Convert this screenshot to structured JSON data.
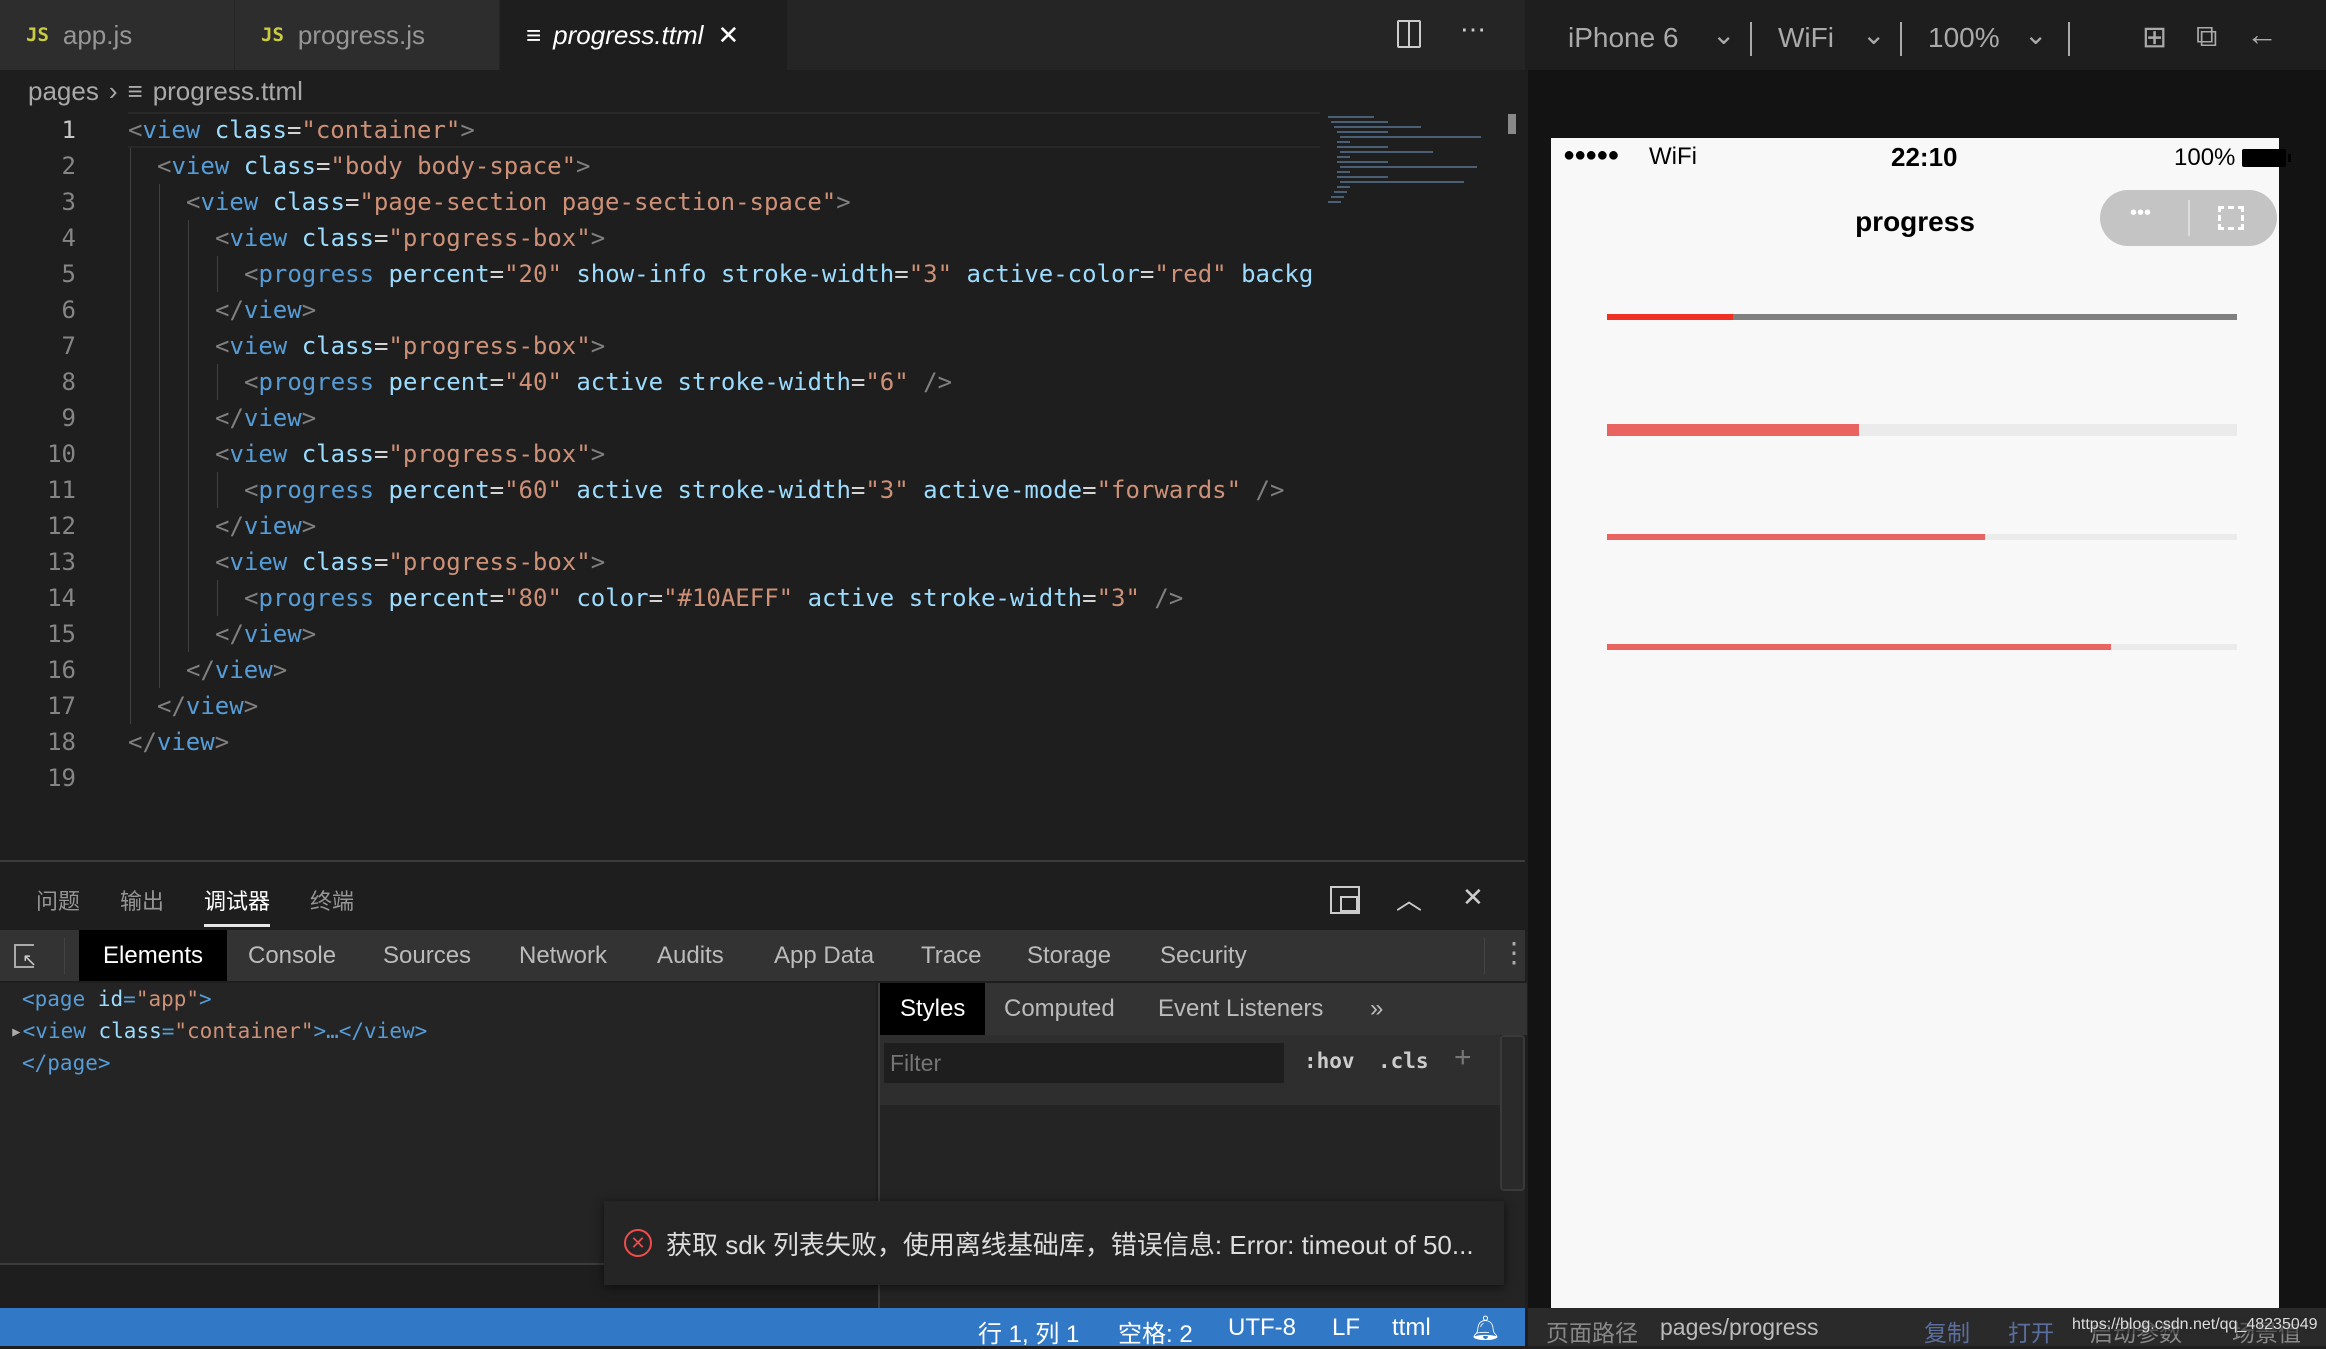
{
  "editor": {
    "tabs": [
      {
        "label": "app.js",
        "icon": "js-icon",
        "badge": "JS"
      },
      {
        "label": "progress.js",
        "icon": "js-icon",
        "badge": "JS"
      },
      {
        "label": "progress.ttml",
        "icon": "file-lines-icon",
        "active": true
      }
    ],
    "breadcrumb": [
      "pages",
      "progress.ttml"
    ],
    "lines": [
      {
        "n": "1",
        "indent": 0,
        "tokens": [
          [
            "pun",
            "<"
          ],
          [
            "tag",
            "view"
          ],
          [
            "txt",
            " "
          ],
          [
            "attr",
            "class"
          ],
          [
            "txt",
            "="
          ],
          [
            "str",
            "\"container\""
          ],
          [
            "pun",
            ">"
          ]
        ]
      },
      {
        "n": "2",
        "indent": 1,
        "tokens": [
          [
            "pun",
            "<"
          ],
          [
            "tag",
            "view"
          ],
          [
            "txt",
            " "
          ],
          [
            "attr",
            "class"
          ],
          [
            "txt",
            "="
          ],
          [
            "str",
            "\"body body-space\""
          ],
          [
            "pun",
            ">"
          ]
        ]
      },
      {
        "n": "3",
        "indent": 2,
        "tokens": [
          [
            "pun",
            "<"
          ],
          [
            "tag",
            "view"
          ],
          [
            "txt",
            " "
          ],
          [
            "attr",
            "class"
          ],
          [
            "txt",
            "="
          ],
          [
            "str",
            "\"page-section page-section-space\""
          ],
          [
            "pun",
            ">"
          ]
        ]
      },
      {
        "n": "4",
        "indent": 3,
        "tokens": [
          [
            "pun",
            "<"
          ],
          [
            "tag",
            "view"
          ],
          [
            "txt",
            " "
          ],
          [
            "attr",
            "class"
          ],
          [
            "txt",
            "="
          ],
          [
            "str",
            "\"progress-box\""
          ],
          [
            "pun",
            ">"
          ]
        ]
      },
      {
        "n": "5",
        "indent": 4,
        "tokens": [
          [
            "pun",
            "<"
          ],
          [
            "tag",
            "progress"
          ],
          [
            "txt",
            " "
          ],
          [
            "attr",
            "percent"
          ],
          [
            "txt",
            "="
          ],
          [
            "str",
            "\"20\""
          ],
          [
            "txt",
            " "
          ],
          [
            "attr",
            "show-info"
          ],
          [
            "txt",
            " "
          ],
          [
            "attr",
            "stroke-width"
          ],
          [
            "txt",
            "="
          ],
          [
            "str",
            "\"3\""
          ],
          [
            "txt",
            " "
          ],
          [
            "attr",
            "active-color"
          ],
          [
            "txt",
            "="
          ],
          [
            "str",
            "\"red\""
          ],
          [
            "txt",
            " "
          ],
          [
            "attr",
            "backg"
          ]
        ]
      },
      {
        "n": "6",
        "indent": 3,
        "tokens": [
          [
            "pun",
            "</"
          ],
          [
            "tag",
            "view"
          ],
          [
            "pun",
            ">"
          ]
        ]
      },
      {
        "n": "7",
        "indent": 3,
        "tokens": [
          [
            "pun",
            "<"
          ],
          [
            "tag",
            "view"
          ],
          [
            "txt",
            " "
          ],
          [
            "attr",
            "class"
          ],
          [
            "txt",
            "="
          ],
          [
            "str",
            "\"progress-box\""
          ],
          [
            "pun",
            ">"
          ]
        ]
      },
      {
        "n": "8",
        "indent": 4,
        "tokens": [
          [
            "pun",
            "<"
          ],
          [
            "tag",
            "progress"
          ],
          [
            "txt",
            " "
          ],
          [
            "attr",
            "percent"
          ],
          [
            "txt",
            "="
          ],
          [
            "str",
            "\"40\""
          ],
          [
            "txt",
            " "
          ],
          [
            "attr",
            "active"
          ],
          [
            "txt",
            " "
          ],
          [
            "attr",
            "stroke-width"
          ],
          [
            "txt",
            "="
          ],
          [
            "str",
            "\"6\""
          ],
          [
            "txt",
            " "
          ],
          [
            "pun",
            "/>"
          ]
        ]
      },
      {
        "n": "9",
        "indent": 3,
        "tokens": [
          [
            "pun",
            "</"
          ],
          [
            "tag",
            "view"
          ],
          [
            "pun",
            ">"
          ]
        ]
      },
      {
        "n": "10",
        "indent": 3,
        "tokens": [
          [
            "pun",
            "<"
          ],
          [
            "tag",
            "view"
          ],
          [
            "txt",
            " "
          ],
          [
            "attr",
            "class"
          ],
          [
            "txt",
            "="
          ],
          [
            "str",
            "\"progress-box\""
          ],
          [
            "pun",
            ">"
          ]
        ]
      },
      {
        "n": "11",
        "indent": 4,
        "tokens": [
          [
            "pun",
            "<"
          ],
          [
            "tag",
            "progress"
          ],
          [
            "txt",
            " "
          ],
          [
            "attr",
            "percent"
          ],
          [
            "txt",
            "="
          ],
          [
            "str",
            "\"60\""
          ],
          [
            "txt",
            " "
          ],
          [
            "attr",
            "active"
          ],
          [
            "txt",
            " "
          ],
          [
            "attr",
            "stroke-width"
          ],
          [
            "txt",
            "="
          ],
          [
            "str",
            "\"3\""
          ],
          [
            "txt",
            " "
          ],
          [
            "attr",
            "active-mode"
          ],
          [
            "txt",
            "="
          ],
          [
            "str",
            "\"forwards\""
          ],
          [
            "txt",
            " "
          ],
          [
            "pun",
            "/>"
          ]
        ]
      },
      {
        "n": "12",
        "indent": 3,
        "tokens": [
          [
            "pun",
            "</"
          ],
          [
            "tag",
            "view"
          ],
          [
            "pun",
            ">"
          ]
        ]
      },
      {
        "n": "13",
        "indent": 3,
        "tokens": [
          [
            "pun",
            "<"
          ],
          [
            "tag",
            "view"
          ],
          [
            "txt",
            " "
          ],
          [
            "attr",
            "class"
          ],
          [
            "txt",
            "="
          ],
          [
            "str",
            "\"progress-box\""
          ],
          [
            "pun",
            ">"
          ]
        ]
      },
      {
        "n": "14",
        "indent": 4,
        "tokens": [
          [
            "pun",
            "<"
          ],
          [
            "tag",
            "progress"
          ],
          [
            "txt",
            " "
          ],
          [
            "attr",
            "percent"
          ],
          [
            "txt",
            "="
          ],
          [
            "str",
            "\"80\""
          ],
          [
            "txt",
            " "
          ],
          [
            "attr",
            "color"
          ],
          [
            "txt",
            "="
          ],
          [
            "str",
            "\"#10AEFF\""
          ],
          [
            "txt",
            " "
          ],
          [
            "attr",
            "active"
          ],
          [
            "txt",
            " "
          ],
          [
            "attr",
            "stroke-width"
          ],
          [
            "txt",
            "="
          ],
          [
            "str",
            "\"3\""
          ],
          [
            "txt",
            " "
          ],
          [
            "pun",
            "/>"
          ]
        ]
      },
      {
        "n": "15",
        "indent": 3,
        "tokens": [
          [
            "pun",
            "</"
          ],
          [
            "tag",
            "view"
          ],
          [
            "pun",
            ">"
          ]
        ]
      },
      {
        "n": "16",
        "indent": 2,
        "tokens": [
          [
            "pun",
            "</"
          ],
          [
            "tag",
            "view"
          ],
          [
            "pun",
            ">"
          ]
        ]
      },
      {
        "n": "17",
        "indent": 1,
        "tokens": [
          [
            "pun",
            "</"
          ],
          [
            "tag",
            "view"
          ],
          [
            "pun",
            ">"
          ]
        ]
      },
      {
        "n": "18",
        "indent": 0,
        "tokens": [
          [
            "pun",
            "</"
          ],
          [
            "tag",
            "view"
          ],
          [
            "pun",
            ">"
          ]
        ]
      },
      {
        "n": "19",
        "indent": 0,
        "tokens": []
      }
    ]
  },
  "panel": {
    "tabs": [
      "问题",
      "输出",
      "调试器",
      "终端"
    ],
    "active_tab": "调试器",
    "devtools_tabs": [
      "Elements",
      "Console",
      "Sources",
      "Network",
      "Audits",
      "App Data",
      "Trace",
      "Storage",
      "Security"
    ],
    "elements": {
      "line1_open": "<page ",
      "line1_attr": "id",
      "line1_eq": "=",
      "line1_val": "\"app\"",
      "line1_close": ">",
      "line2_open": "<view ",
      "line2_attr": "class",
      "line2_eq": "=",
      "line2_val": "\"container\"",
      "line2_close": ">…</view>",
      "line3": "</page>"
    },
    "styles_tabs": [
      "Styles",
      "Computed",
      "Event Listeners",
      "»"
    ],
    "filter_placeholder": "Filter",
    "hov": ":hov",
    "cls": ".cls",
    "plus": "+",
    "toast": "获取 sdk 列表失败，使用离线基础库，错误信息: Error: timeout of 50..."
  },
  "statusbar": {
    "position": "行 1, 列 1",
    "spaces": "空格: 2",
    "encoding": "UTF-8",
    "eol": "LF",
    "language": "ttml"
  },
  "simulator": {
    "device": "iPhone 6",
    "network": "WiFi",
    "zoom": "100%",
    "phone_status": {
      "signal": "●●●●●",
      "network": "WiFi",
      "time": "22:10",
      "battery": "100%"
    },
    "nav_title": "progress",
    "capsule_more": "•••",
    "progress_bars": [
      {
        "percent": 20,
        "active_color": "#EE3124",
        "background_color": "#808080"
      },
      {
        "percent": 40,
        "active_color": "#E96361",
        "background_color": "#EBEBEB"
      },
      {
        "percent": 60,
        "active_color": "#E96361",
        "background_color": "#EBEBEB"
      },
      {
        "percent": 80,
        "active_color": "#E96361",
        "background_color": "#EBEBEB"
      }
    ],
    "footer": {
      "path_label": "页面路径",
      "path": "pages/progress",
      "copy": "复制",
      "open": "打开",
      "params": "启动参数",
      "scene": "场景值",
      "watermark": "https://blog.csdn.net/qq_48235049"
    }
  },
  "colors": {
    "statusbar": "#3178C6",
    "accent_tag": "#569CD6",
    "string": "#CE9178",
    "attr": "#9CDCFE"
  }
}
